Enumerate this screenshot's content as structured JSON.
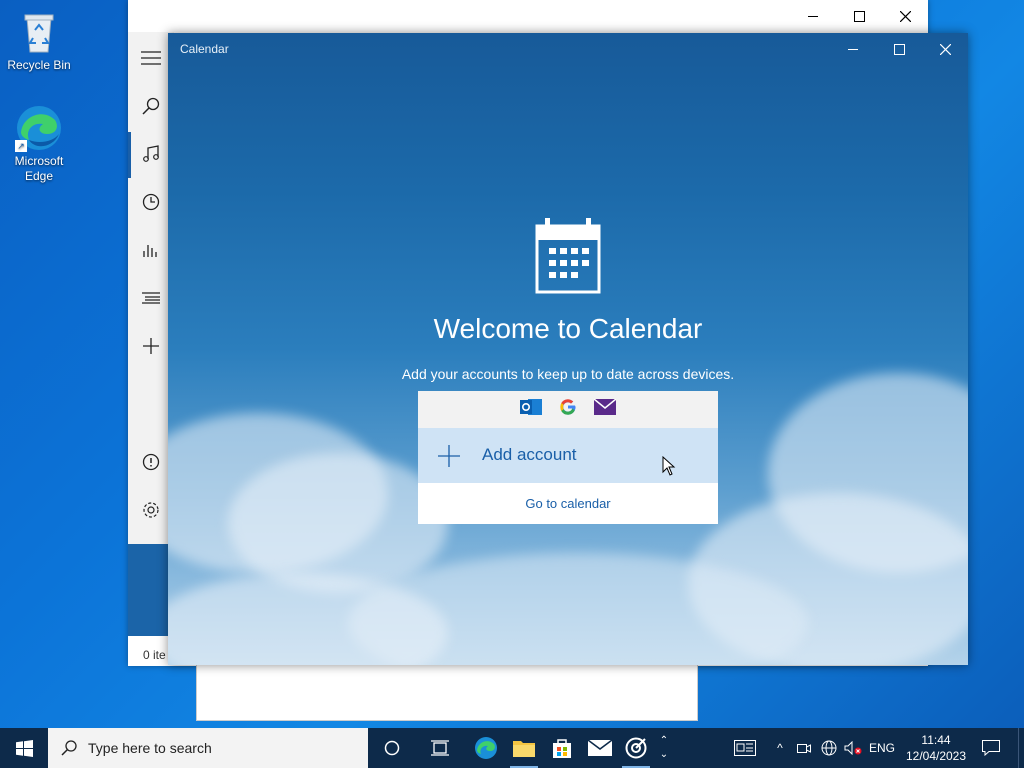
{
  "desktop": {
    "icons": [
      {
        "label": "Recycle Bin",
        "icon": "recycle-bin-icon"
      },
      {
        "label": "Microsoft Edge",
        "icon": "edge-icon"
      }
    ]
  },
  "background_window": {
    "nav_icons": [
      "hamburger-menu-icon",
      "search-icon",
      "music-note-icon",
      "recent-clock-icon",
      "charts-icon",
      "now-playing-list-icon",
      "add-icon",
      "info-icon",
      "settings-gear-icon"
    ],
    "status_text": "0 ite"
  },
  "calendar_window": {
    "title": "Calendar",
    "heading": "Welcome to Calendar",
    "subtitle": "Add your accounts to keep up to date across devices.",
    "account_icons": [
      "outlook-icon",
      "google-icon",
      "mail-icon"
    ],
    "add_account_label": "Add account",
    "goto_label": "Go to calendar",
    "accent_color": "#1a5fa8"
  },
  "taskbar": {
    "search_placeholder": "Type here to search",
    "language": "ENG",
    "time": "11:44",
    "date": "12/04/2023"
  }
}
